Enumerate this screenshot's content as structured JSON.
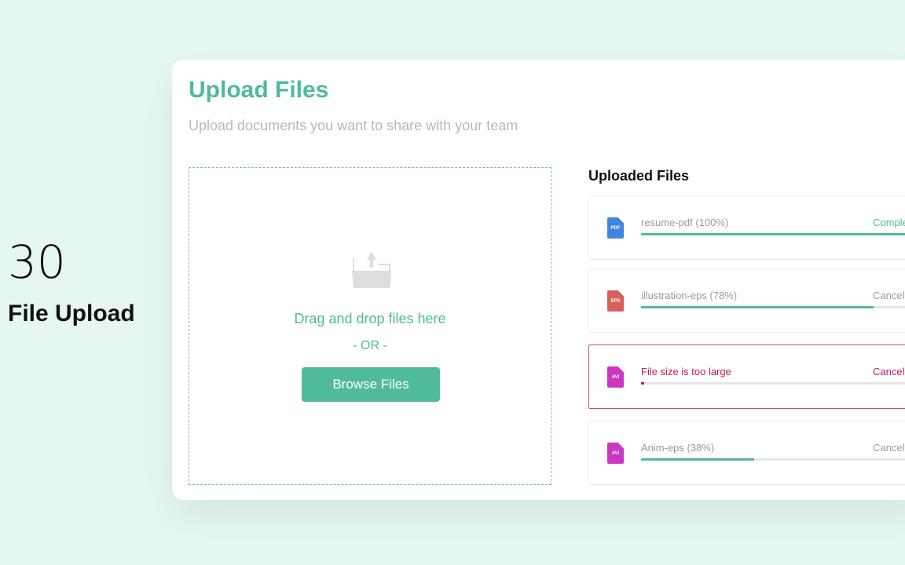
{
  "badge": {
    "number": "30",
    "label": "File Upload"
  },
  "header": {
    "title": "Upload Files",
    "subtitle": "Upload documents you want to share with your team"
  },
  "dropzone": {
    "icon": "folder-upload-icon",
    "text": "Drag and drop files here",
    "or": "- OR -",
    "browse_label": "Browse Files"
  },
  "uploaded": {
    "title": "Uploaded Files",
    "items": [
      {
        "type": "PDF",
        "name": "resume-pdf (100%)",
        "action": "Complete",
        "progress": 100,
        "icon_color": "#3f86e0",
        "state": "complete"
      },
      {
        "type": "EPS",
        "name": "illustration-eps (78%)",
        "action": "Cancel",
        "progress": 78,
        "icon_color": "#d8605d",
        "state": "uploading"
      },
      {
        "type": "AVI",
        "name": "File size is too large",
        "action": "Cancel",
        "progress": 1,
        "icon_color": "#cc36c1",
        "state": "error"
      },
      {
        "type": "AVI",
        "name": "Anim-eps (38%)",
        "action": "Cancel",
        "progress": 38,
        "icon_color": "#cc36c1",
        "state": "uploading"
      }
    ]
  },
  "colors": {
    "accent": "#50bb9b",
    "error": "#c2185b"
  }
}
